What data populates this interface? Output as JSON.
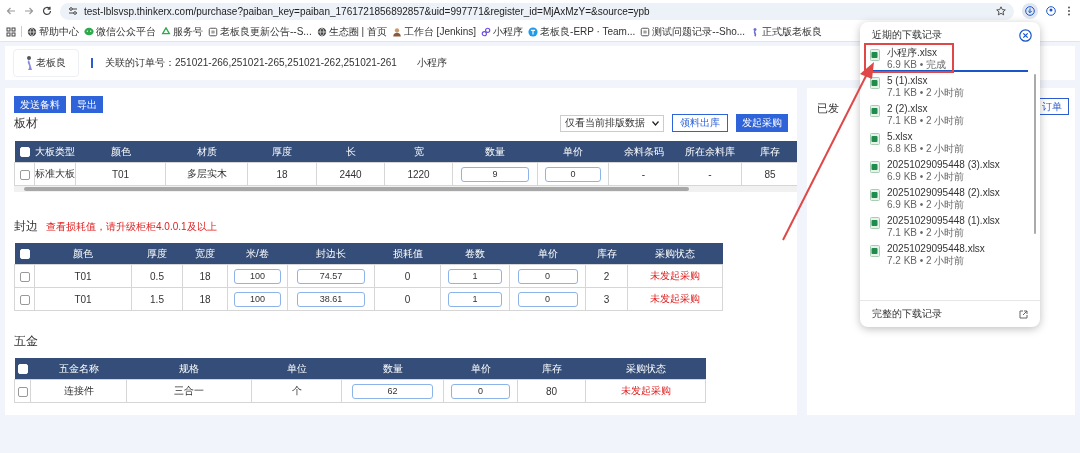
{
  "browser": {
    "url": "test-lblsvsp.thinkerx.com/purchase?paiban_key=paiban_1761721856892857&uid=997771&register_id=MjAxMzY=&source=ypb",
    "bookmarks": [
      {
        "kind": "globe",
        "label": "帮助中心"
      },
      {
        "kind": "chat",
        "label": "微信公众平台"
      },
      {
        "kind": "recycle",
        "label": "服务号"
      },
      {
        "kind": "doc",
        "label": "老板良更新公告--S..."
      },
      {
        "kind": "globe",
        "label": "生态圈 | 首页"
      },
      {
        "kind": "person",
        "label": "工作台 [Jenkins]"
      },
      {
        "kind": "link",
        "label": "小程序"
      },
      {
        "kind": "team",
        "label": "老板良-ERP · Team..."
      },
      {
        "kind": "doc",
        "label": "测试问题记录--Sho..."
      },
      {
        "kind": "figure",
        "label": "正式版老板良"
      }
    ]
  },
  "header": {
    "logo_text": "老板良",
    "orders": "关联的订单号：251021-266,251021-265,251021-262,251021-261",
    "tag": "小程序"
  },
  "actions": [
    "发送备料",
    "导出"
  ],
  "boards": {
    "title": "板材",
    "filter": "仅看当前排版数据",
    "buttons": [
      {
        "label": "领料出库",
        "kind": "outline"
      },
      {
        "label": "发起采购",
        "kind": "primary"
      }
    ],
    "all_checked": false,
    "columns": [
      "大板类型",
      "颜色",
      "材质",
      "厚度",
      "长",
      "宽",
      "数量",
      "单价",
      "余料条码",
      "所在余料库",
      "库存"
    ],
    "rows": [
      {
        "checked": false,
        "cells": [
          {
            "kind": "text",
            "value": "标准大板"
          },
          {
            "kind": "text",
            "value": "T01"
          },
          {
            "kind": "text",
            "value": "多层实木"
          },
          {
            "kind": "text",
            "value": "18"
          },
          {
            "kind": "text",
            "value": "2440"
          },
          {
            "kind": "text",
            "value": "1220"
          },
          {
            "kind": "input",
            "value": "9"
          },
          {
            "kind": "input",
            "value": "0"
          },
          {
            "kind": "text",
            "value": "-"
          },
          {
            "kind": "text",
            "value": "-"
          },
          {
            "kind": "text",
            "value": "85"
          }
        ]
      }
    ]
  },
  "edges": {
    "title": "封边",
    "note": "查看损耗值，请升级柜柜4.0.0.1及以上",
    "all_checked": false,
    "columns": [
      "颜色",
      "厚度",
      "宽度",
      "米/卷",
      "封边长",
      "损耗值",
      "卷数",
      "单价",
      "库存",
      "采购状态"
    ],
    "rows": [
      {
        "checked": false,
        "cells": [
          {
            "kind": "text",
            "value": "T01"
          },
          {
            "kind": "text",
            "value": "0.5"
          },
          {
            "kind": "text",
            "value": "18"
          },
          {
            "kind": "input",
            "value": "100"
          },
          {
            "kind": "input",
            "value": "74.57"
          },
          {
            "kind": "text",
            "value": "0"
          },
          {
            "kind": "input",
            "value": "1"
          },
          {
            "kind": "input",
            "value": "0"
          },
          {
            "kind": "text",
            "value": "2"
          },
          {
            "kind": "status",
            "value": "未发起采购"
          }
        ]
      },
      {
        "checked": false,
        "cells": [
          {
            "kind": "text",
            "value": "T01"
          },
          {
            "kind": "text",
            "value": "1.5"
          },
          {
            "kind": "text",
            "value": "18"
          },
          {
            "kind": "input",
            "value": "100"
          },
          {
            "kind": "input",
            "value": "38.61"
          },
          {
            "kind": "text",
            "value": "0"
          },
          {
            "kind": "input",
            "value": "1"
          },
          {
            "kind": "input",
            "value": "0"
          },
          {
            "kind": "text",
            "value": "3"
          },
          {
            "kind": "status",
            "value": "未发起采购"
          }
        ]
      }
    ]
  },
  "hardware": {
    "title": "五金",
    "all_checked": false,
    "columns": [
      "五金名称",
      "规格",
      "单位",
      "数量",
      "单价",
      "库存",
      "采购状态"
    ],
    "rows": [
      {
        "checked": false,
        "cells": [
          {
            "kind": "text",
            "value": "连接件"
          },
          {
            "kind": "text",
            "value": "三合一"
          },
          {
            "kind": "text",
            "value": "个"
          },
          {
            "kind": "input",
            "value": "62"
          },
          {
            "kind": "input",
            "value": "0"
          },
          {
            "kind": "text",
            "value": "80"
          },
          {
            "kind": "status",
            "value": "未发起采购"
          }
        ]
      }
    ]
  },
  "side_panel": {
    "title": "已发",
    "button": "订单"
  },
  "downloads": {
    "title": "近期的下载记录",
    "footer": "完整的下载记录",
    "items": [
      {
        "name": "小程序.xlsx",
        "meta": "6.9 KB • 完成",
        "selected": true
      },
      {
        "name": "5 (1).xlsx",
        "meta": "7.1 KB • 2 小时前",
        "selected": false
      },
      {
        "name": "2 (2).xlsx",
        "meta": "7.1 KB • 2 小时前",
        "selected": false
      },
      {
        "name": "5.xlsx",
        "meta": "6.8 KB • 2 小时前",
        "selected": false
      },
      {
        "name": "20251029095448 (3).xlsx",
        "meta": "6.9 KB • 2 小时前",
        "selected": false
      },
      {
        "name": "20251029095448 (2).xlsx",
        "meta": "6.9 KB • 2 小时前",
        "selected": false
      },
      {
        "name": "20251029095448 (1).xlsx",
        "meta": "7.1 KB • 2 小时前",
        "selected": false
      },
      {
        "name": "20251029095448.xlsx",
        "meta": "7.2 KB • 2 小时前",
        "selected": false
      }
    ]
  }
}
